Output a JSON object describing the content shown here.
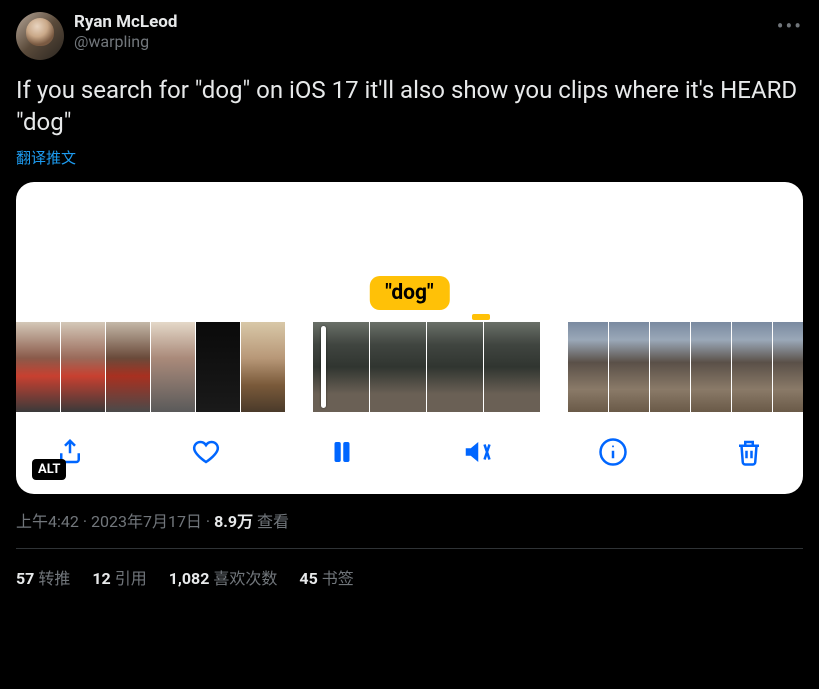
{
  "header": {
    "display_name": "Ryan McLeod",
    "handle": "@warpling"
  },
  "content": {
    "text": "If you search for \"dog\" on iOS 17 it'll also show you clips where it's HEARD \"dog\"",
    "translate_label": "翻译推文"
  },
  "media": {
    "tag_text": "\"dog\"",
    "alt_badge": "ALT"
  },
  "meta": {
    "time": "上午4:42",
    "sep1": " · ",
    "date": "2023年7月17日",
    "sep2": " · ",
    "views_num": "8.9万",
    "views_label": " 查看"
  },
  "stats": {
    "retweets_num": "57",
    "retweets_label": "转推",
    "quotes_num": "12",
    "quotes_label": "引用",
    "likes_num": "1,082",
    "likes_label": "喜欢次数",
    "bookmarks_num": "45",
    "bookmarks_label": "书签"
  }
}
